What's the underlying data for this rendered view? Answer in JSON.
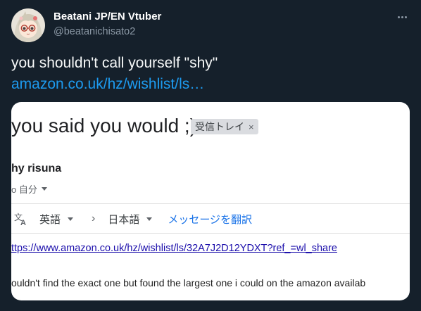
{
  "tweet": {
    "display_name": "Beatani JP/EN Vtuber",
    "handle": "@beatanichisato2",
    "text": "you shouldn't call yourself \"shy\"",
    "link": "amazon.co.uk/hz/wishlist/ls…",
    "more_icon": "more-horizontal-icon",
    "avatar": "avatar-anime-girl-glasses"
  },
  "email": {
    "subject": "you said you would ;)",
    "inbox_chip": "受信トレイ",
    "chip_close": "×",
    "sender": "hy risuna",
    "recipient": "o 自分",
    "translate": {
      "source_language": "英語",
      "arrow": "›",
      "target_language": "日本語",
      "action": "メッセージを翻訳",
      "icon": "translate-icon"
    },
    "url": "ttps://www.amazon.co.uk/hz/wishlist/ls/32A7J2D12YDXT?ref_=wl_share",
    "body": "ouldn't find the exact one but found the largest one i could on the amazon availab"
  },
  "colors": {
    "background": "#15202b",
    "name": "#ffffff",
    "handle": "#8b98a5",
    "link": "#1d9bf0",
    "email_link": "#1a0dab",
    "translate_action": "#1a73e8"
  }
}
